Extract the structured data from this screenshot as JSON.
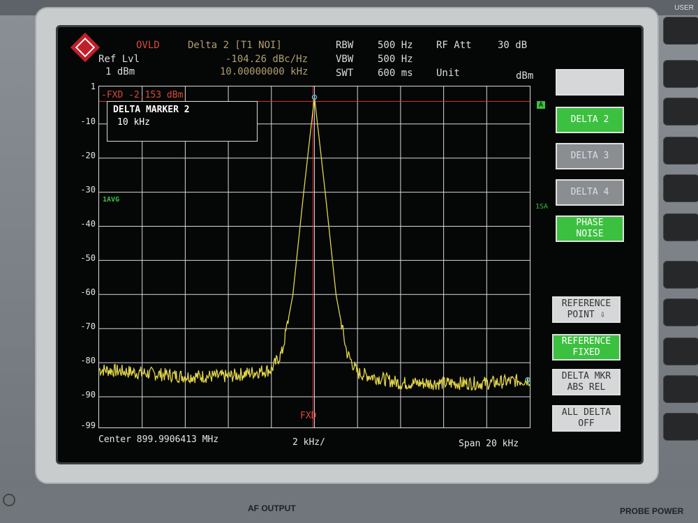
{
  "top_right_label": "USER",
  "header": {
    "ovld": "OVLD",
    "delta_label": "Delta 2 [T1 NOI]",
    "delta_value": "-104.26 dBc/Hz",
    "delta_freq": "10.00000000 kHz",
    "ref_lvl_label": "Ref Lvl",
    "ref_lvl_value": "1 dBm",
    "rbw_label": "RBW",
    "rbw_value": "500 Hz",
    "vbw_label": "VBW",
    "vbw_value": "500 Hz",
    "swt_label": "SWT",
    "swt_value": "600 ms",
    "rf_att_label": "RF Att",
    "rf_att_value": "30 dB",
    "unit_label": "Unit",
    "unit_value": "dBm"
  },
  "plot": {
    "fxd_line_label": "-FXD -2.153 dBm",
    "fxd_bottom": "FXD",
    "trace_mode": "1AVG",
    "trace_a_label": "A",
    "sa_label": "1SA",
    "y_ticks": [
      "1",
      "-10",
      "-20",
      "-30",
      "-40",
      "-50",
      "-60",
      "-70",
      "-80",
      "-90",
      "-99"
    ],
    "marker_box": {
      "title": "DELTA MARKER 2",
      "value": "10 kHz"
    }
  },
  "footer": {
    "center": "Center 899.9906413 MHz",
    "per_div": "2 kHz/",
    "span": "Span 20 kHz"
  },
  "softkeys": [
    {
      "label": "",
      "state": "light"
    },
    {
      "label": "DELTA 2",
      "state": "on"
    },
    {
      "label": "DELTA 3",
      "state": "off"
    },
    {
      "label": "DELTA 4",
      "state": "off"
    },
    {
      "label": "PHASE\nNOISE",
      "state": "on"
    },
    {
      "label": "REFERENCE\nPOINT ⇩",
      "state": "light"
    },
    {
      "label": "REFERENCE\nFIXED",
      "state": "on"
    },
    {
      "label": "DELTA MKR\nABS REL",
      "state": "mixed"
    },
    {
      "label": "ALL DELTA\nOFF",
      "state": "light"
    }
  ],
  "bottom_labels": {
    "af_output": "AF OUTPUT",
    "probe_power": "PROBE POWER"
  },
  "colors": {
    "trace": "#e2d64a",
    "grid": "#d8d8d8",
    "fxd_line": "#d9383a",
    "softkey_on": "#3cc040"
  },
  "chart_data": {
    "type": "line",
    "xlabel": "",
    "ylabel": "",
    "x_span_khz": 20,
    "ylim": [
      -99,
      1
    ],
    "x": [
      -10,
      -8,
      -6,
      -4,
      -2,
      -1.5,
      -1,
      -0.5,
      0,
      0.5,
      1,
      1.5,
      2,
      4,
      6,
      8,
      10
    ],
    "values": [
      -82,
      -83,
      -84,
      -84,
      -82,
      -77,
      -60,
      -30,
      -2.153,
      -30,
      -60,
      -77,
      -83,
      -86,
      -86,
      -86,
      -85
    ],
    "markers": [
      {
        "name": "T1",
        "x": 0,
        "y": -2.153
      },
      {
        "name": "Delta 2",
        "x": 10,
        "y": -85
      }
    ]
  }
}
